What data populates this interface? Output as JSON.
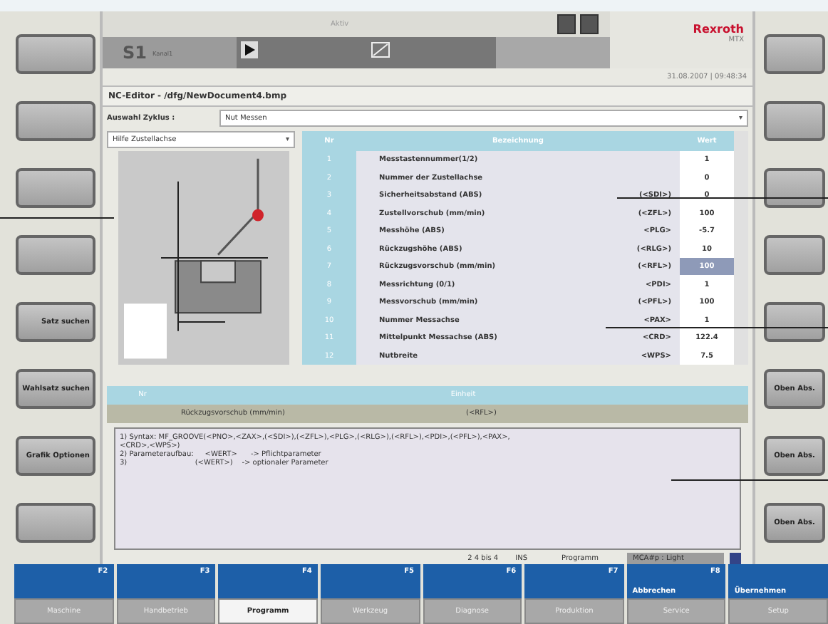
{
  "header": {
    "channel": "S1",
    "channel_label": "Kanal1",
    "mode_label": "Aktiv",
    "logo": "Rexroth",
    "logo_sub": "MTX",
    "datetime": "31.08.2007 | 09:48:34"
  },
  "editor": {
    "title": "NC-Editor - /dfg/NewDocument4.bmp",
    "cycle_label": "Auswahl Zyklus :",
    "cycle_value": "Nut Messen",
    "cycle_caret": "▾",
    "help_select": "Hilfe Zustellachse",
    "help_caret": "▾"
  },
  "table": {
    "columns": [
      "Nr",
      "Bezeichnung",
      "Wert"
    ],
    "rows": [
      {
        "nr": "1",
        "name": "Messtastennummer(1/2)",
        "param": "",
        "value": "1",
        "selected": false
      },
      {
        "nr": "2",
        "name": "Nummer der Zustellachse",
        "param": "",
        "value": "0",
        "selected": false
      },
      {
        "nr": "3",
        "name": "Sicherheitsabstand (ABS)",
        "param": "(<SDI>)",
        "value": "0",
        "selected": false
      },
      {
        "nr": "4",
        "name": "Zustellvorschub (mm/min)",
        "param": "(<ZFL>)",
        "value": "100",
        "selected": false
      },
      {
        "nr": "5",
        "name": "Messhöhe (ABS)",
        "param": "<PLG>",
        "value": "-5.7",
        "selected": false
      },
      {
        "nr": "6",
        "name": "Rückzugshöhe (ABS)",
        "param": "(<RLG>)",
        "value": "10",
        "selected": false
      },
      {
        "nr": "7",
        "name": "Rückzugsvorschub (mm/min)",
        "param": "(<RFL>)",
        "value": "100",
        "selected": true
      },
      {
        "nr": "8",
        "name": "Messrichtung (0/1)",
        "param": "<PDI>",
        "value": "1",
        "selected": false
      },
      {
        "nr": "9",
        "name": "Messvorschub (mm/min)",
        "param": "(<PFL>)",
        "value": "100",
        "selected": false
      },
      {
        "nr": "10",
        "name": "Nummer Messachse",
        "param": "<PAX>",
        "value": "1",
        "selected": false
      },
      {
        "nr": "11",
        "name": "Mittelpunkt Messachse (ABS)",
        "param": "<CRD>",
        "value": "122.4",
        "selected": false
      },
      {
        "nr": "12",
        "name": "Nutbreite",
        "param": "<WPS>",
        "value": "7.5",
        "selected": false
      }
    ]
  },
  "detail": {
    "columns": [
      "Nr",
      "Einheit"
    ],
    "name": "Rückzugsvorschub (mm/min)",
    "param": "(<RFL>)"
  },
  "help_text": [
    "1) Syntax: MF_GROOVE(<PNO>,<ZAX>,(<SDI>),(<ZFL>),<PLG>,(<RLG>),(<RFL>),<PDI>,(<PFL>),<PAX>,",
    "<CRD>,<WPS>)",
    "2) Parameteraufbau:     <WERT>      -> Pflichtparameter",
    "3)                              (<WERT>)    -> optionaler Parameter"
  ],
  "status_bar": [
    "2  4 bis 4",
    "INS",
    "Programm",
    "MCA#p : Light"
  ],
  "left_softkeys": [
    {
      "kind": "blank"
    },
    {
      "kind": "blank"
    },
    {
      "kind": "blank"
    },
    {
      "kind": "blank"
    },
    {
      "kind": "text",
      "label": "Satz suchen"
    },
    {
      "kind": "text",
      "label": "Wahlsatz suchen"
    },
    {
      "kind": "text",
      "label": "Grafik Optionen"
    },
    {
      "kind": "blank"
    }
  ],
  "right_softkeys": [
    {
      "kind": "blank"
    },
    {
      "kind": "blank"
    },
    {
      "kind": "blank"
    },
    {
      "kind": "blank"
    },
    {
      "kind": "blank"
    },
    {
      "kind": "text",
      "label": "Oben Abs."
    },
    {
      "kind": "text",
      "label": "Oben Abs."
    },
    {
      "kind": "text",
      "label": "Oben Abs."
    }
  ],
  "function_keys": [
    {
      "key": "F2"
    },
    {
      "key": "F3"
    },
    {
      "key": "F4"
    },
    {
      "key": "F5"
    },
    {
      "key": "F6"
    },
    {
      "key": "F7"
    },
    {
      "key": "F8",
      "label": "Abbrechen"
    },
    {
      "label": "Übernehmen"
    }
  ],
  "bottom_tabs": [
    {
      "label": "Maschine",
      "selected": false
    },
    {
      "label": "Handbetrieb",
      "selected": false
    },
    {
      "label": "Programm",
      "selected": true
    },
    {
      "label": "Werkzeug",
      "selected": false
    },
    {
      "label": "Diagnose",
      "selected": false
    },
    {
      "label": "Produktion",
      "selected": false
    },
    {
      "label": "Service",
      "selected": false
    },
    {
      "label": "Setup",
      "selected": false
    }
  ]
}
